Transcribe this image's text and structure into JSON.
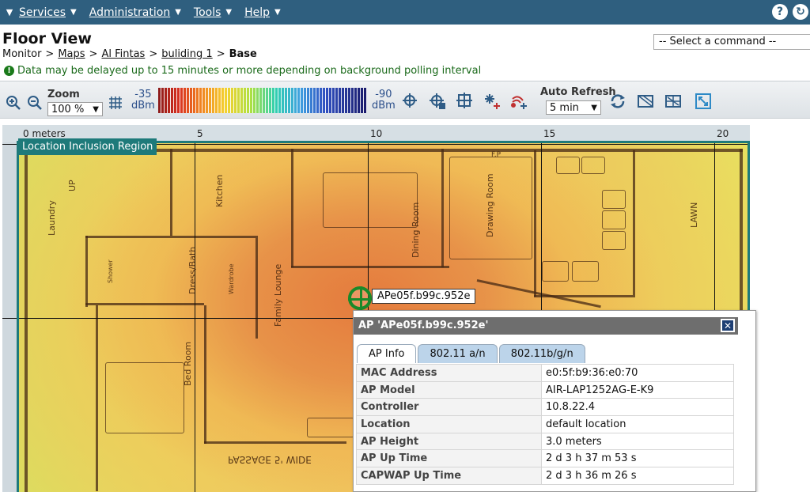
{
  "menubar": {
    "items": [
      {
        "label": "Services"
      },
      {
        "label": "Administration"
      },
      {
        "label": "Tools"
      },
      {
        "label": "Help"
      }
    ]
  },
  "header": {
    "title": "Floor View",
    "breadcrumb": {
      "monitor": "Monitor",
      "maps": "Maps",
      "campus": "Al Fintas",
      "building": "buliding 1",
      "current": "Base"
    },
    "command_select": "-- Select a command --",
    "info_message": "Data may be delayed up to 15 minutes or more depending on background polling interval"
  },
  "toolbar": {
    "zoom_label": "Zoom",
    "zoom_value": "100 %",
    "dbm_high_value": "-35",
    "dbm_high_unit": "dBm",
    "dbm_low_value": "-90",
    "dbm_low_unit": "dBm",
    "auto_refresh_label": "Auto Refresh",
    "auto_refresh_value": "5 min"
  },
  "map": {
    "ruler": [
      "0 meters",
      "5",
      "10",
      "15",
      "20"
    ],
    "region_label": "Location Inclusion Region",
    "rooms": {
      "laundry": "Laundry",
      "kitchen": "Kitchen",
      "dining": "Dining Room",
      "drawing": "Drawing Room",
      "lawn": "LAWN",
      "dress": "Dress/Bath",
      "wardrobe": "Wardrobe",
      "family": "Family Lounge",
      "bed": "Bed Room",
      "shower": "Shower",
      "passage": "PASSAGE 5' WIDE",
      "up": "UP",
      "fp": "F.P"
    },
    "ap_tag": "APe05f.b99c.952e"
  },
  "ap_popup": {
    "title": "AP 'APe05f.b99c.952e'",
    "tabs": [
      "AP Info",
      "802.11 a/n",
      "802.11b/g/n"
    ],
    "rows": [
      {
        "key": "MAC Address",
        "value": "e0:5f:b9:36:e0:70"
      },
      {
        "key": "AP Model",
        "value": "AIR-LAP1252AG-E-K9"
      },
      {
        "key": "Controller",
        "value": "10.8.22.4"
      },
      {
        "key": "Location",
        "value": "default location"
      },
      {
        "key": "AP Height",
        "value": "3.0 meters"
      },
      {
        "key": "AP Up Time",
        "value": "2 d 3 h 37 m 53 s"
      },
      {
        "key": "CAPWAP Up Time",
        "value": "2 d 3 h 36 m 26 s"
      }
    ]
  }
}
